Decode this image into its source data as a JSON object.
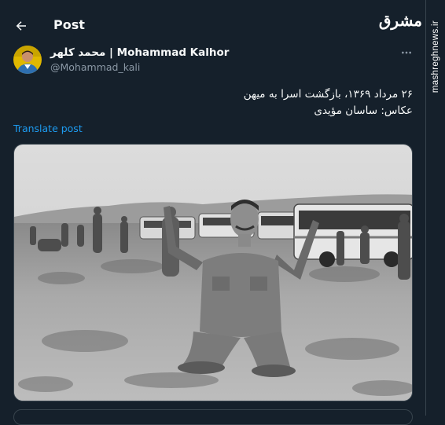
{
  "header": {
    "title": "Post"
  },
  "author": {
    "display_name": "محمد کلهر | Mohammad Kalhor",
    "handle": "@Mohammad_kali"
  },
  "tweet": {
    "lines": [
      "۲۶ مرداد ۱۳۶۹، بازگشت اسرا به میهن",
      "عکاس: ساسان مؤیدی"
    ],
    "translate_label": "Translate post"
  },
  "media": {
    "alt": "Black and white photograph: a returning prisoner of war kneeling on the ground with arms raised, buses and people in the background"
  },
  "watermark": {
    "logo": "مشرق",
    "url": "mashreghnews.ir"
  },
  "colors": {
    "background": "#15202b",
    "text_primary": "#f7f9f9",
    "text_secondary": "#8b98a5",
    "link": "#1d9bf0",
    "border": "#38444d"
  },
  "icons": {
    "back": "arrow-left-icon",
    "more": "more-horizontal-icon"
  }
}
